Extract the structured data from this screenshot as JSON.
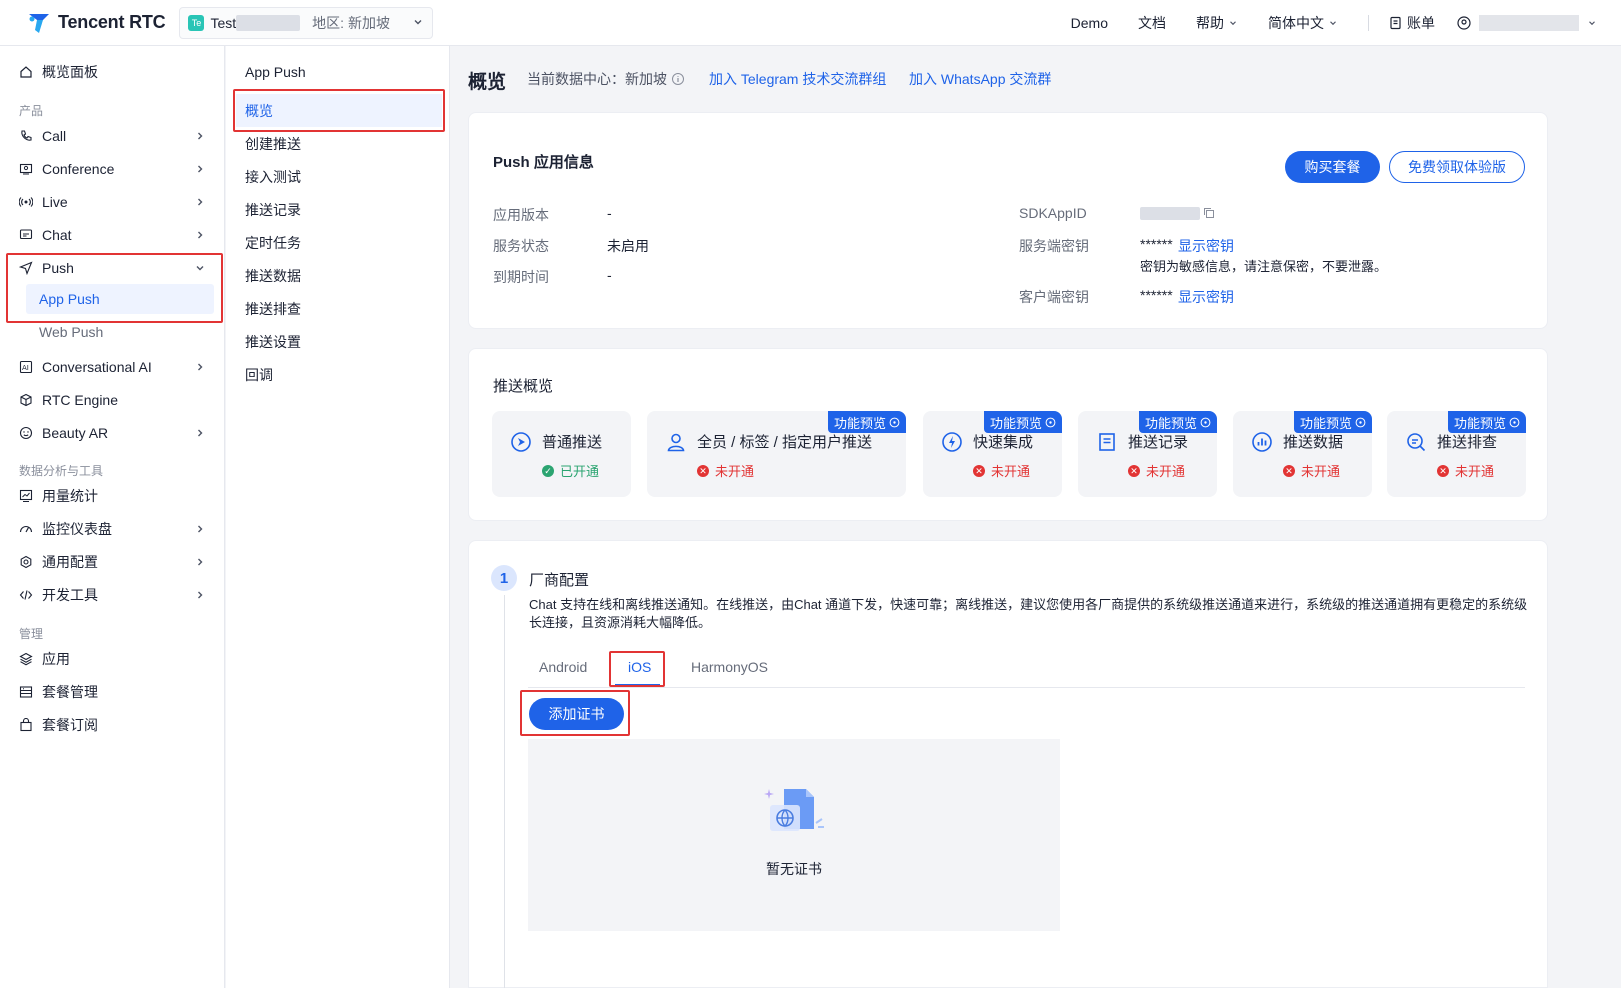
{
  "topbar": {
    "brand": "Tencent RTC",
    "app_badge": "Te",
    "app_name": "Test",
    "region": "地区: 新加坡",
    "links": [
      "Demo",
      "文档",
      "帮助",
      "简体中文"
    ],
    "billing": "账单"
  },
  "sidebar": {
    "overview": "概览面板",
    "group_products": "产品",
    "products": [
      "Call",
      "Conference",
      "Live",
      "Chat",
      "Push"
    ],
    "push_subitems": [
      "App Push",
      "Web Push"
    ],
    "products_more": [
      "Conversational AI",
      "RTC Engine",
      "Beauty AR"
    ],
    "group_analytics": "数据分析与工具",
    "analytics": [
      "用量统计",
      "监控仪表盘",
      "通用配置",
      "开发工具"
    ],
    "group_manage": "管理",
    "manage": [
      "应用",
      "套餐管理",
      "套餐订阅"
    ]
  },
  "subnav": {
    "title": "App Push",
    "items": [
      "概览",
      "创建推送",
      "接入测试",
      "推送记录",
      "定时任务",
      "推送数据",
      "推送排查",
      "推送设置",
      "回调"
    ]
  },
  "main": {
    "title": "概览",
    "data_center": "当前数据中心：新加坡",
    "telegram_link": "加入 Telegram 技术交流群组",
    "whatsapp_link": "加入 WhatsApp 交流群"
  },
  "app_info": {
    "title": "Push 应用信息",
    "buy_button": "购买套餐",
    "trial_button": "免费领取体验版",
    "version_label": "应用版本",
    "version_value": "-",
    "status_label": "服务状态",
    "status_value": "未启用",
    "expiry_label": "到期时间",
    "expiry_value": "-",
    "sdkappid_label": "SDKAppID",
    "server_key_label": "服务端密钥",
    "server_key_mask": "******",
    "show_key": "显示密钥",
    "key_warning": "密钥为敏感信息，请注意保密，不要泄露。",
    "client_key_label": "客户端密钥",
    "client_key_mask": "******"
  },
  "overview": {
    "title": "推送概览",
    "preview_tag": "功能预览",
    "features": [
      {
        "name": "普通推送",
        "status": "已开通",
        "enabled": true
      },
      {
        "name": "全员 / 标签 / 指定用户推送",
        "status": "未开通",
        "enabled": false
      },
      {
        "name": "快速集成",
        "status": "未开通",
        "enabled": false
      },
      {
        "name": "推送记录",
        "status": "未开通",
        "enabled": false
      },
      {
        "name": "推送数据",
        "status": "未开通",
        "enabled": false
      },
      {
        "name": "推送排查",
        "status": "未开通",
        "enabled": false
      }
    ]
  },
  "vendor": {
    "step": "1",
    "title": "厂商配置",
    "description": "Chat 支持在线和离线推送通知。在线推送，由Chat 通道下发，快速可靠；离线推送，建议您使用各厂商提供的系统级推送通道来进行，系统级的推送通道拥有更稳定的系统级长连接，且资源消耗大幅降低。",
    "tabs": [
      "Android",
      "iOS",
      "HarmonyOS"
    ],
    "active_tab": "iOS",
    "add_cert_button": "添加证书",
    "empty_text": "暂无证书"
  },
  "colors": {
    "primary": "#1f63e8",
    "highlight": "#e23434",
    "success": "#2ba471"
  }
}
